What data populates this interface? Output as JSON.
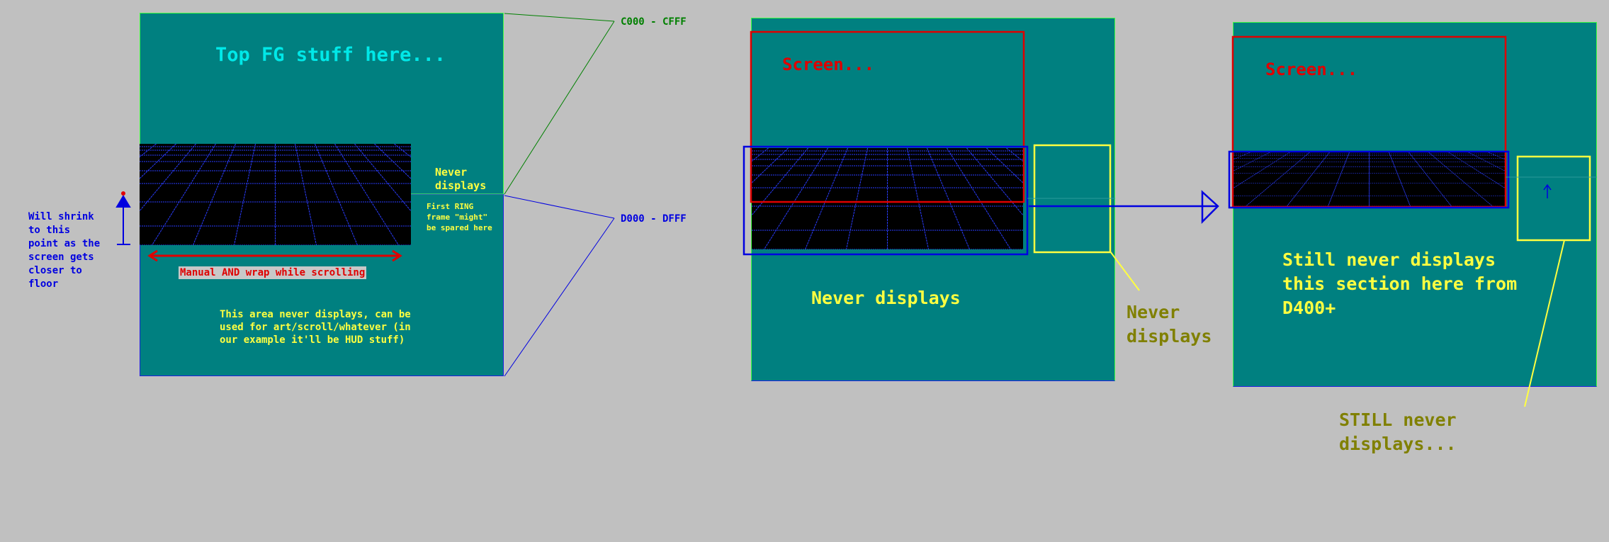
{
  "colors": {
    "background": "#c0c0c0",
    "panel": "#008080",
    "cyan": "#00e0e0",
    "yellow": "#ffff40",
    "red": "#e00000",
    "blue": "#0000e0",
    "green": "#008000",
    "olive": "#808000"
  },
  "diagram1": {
    "top_label": "Top FG stuff here...",
    "never_displays": "Never\ndisplays",
    "first_ring": "First RING\nframe \"might\"\nbe spared here",
    "manual_wrap": "Manual AND wrap while scrolling",
    "hud_area": "This area never displays, can be\nused for art/scroll/whatever (in\nour example it'll be HUD stuff)",
    "shrink_note": "Will shrink\nto this\npoint as the\nscreen gets\ncloser to\nfloor"
  },
  "memory_labels": {
    "upper": "C000 - CFFF",
    "lower": "D000 - DFFF"
  },
  "diagram2": {
    "screen_label": "Screen...",
    "never_displays": "Never displays",
    "side_never": "Never\ndisplays"
  },
  "diagram3": {
    "screen_label": "Screen...",
    "still_never": "Still never displays\nthis section here from\nD400+",
    "still_never_bottom": "STILL never\ndisplays..."
  },
  "icons": {
    "floor_grid": "perspective-grid-floor",
    "up_arrow": "up-arrow-icon",
    "double_arrow": "double-arrow-icon",
    "right_arrow": "right-arrow-icon"
  }
}
